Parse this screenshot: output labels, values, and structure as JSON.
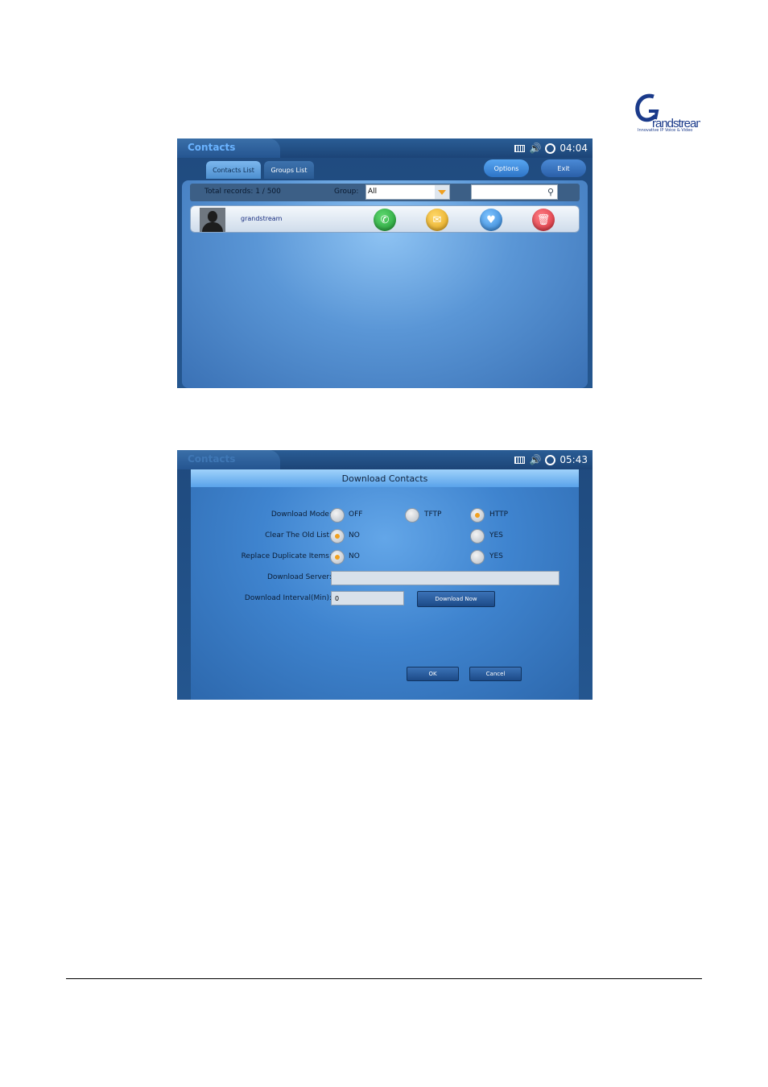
{
  "logo": {
    "text": "Grandstream",
    "tagline": "Innovative IP Voice & Video"
  },
  "screen1": {
    "app_title": "Contacts",
    "time": "04:04",
    "tabs": [
      "Contacts List",
      "Groups List"
    ],
    "options_label": "Options",
    "exit_label": "Exit",
    "total_records": "Total records: 1 / 500",
    "group_label": "Group:",
    "group_value": "All",
    "contact_name": "grandstream"
  },
  "screen2": {
    "app_title": "Contacts",
    "time": "05:43",
    "dialog_title": "Download Contacts",
    "download_mode_label": "Download Mode:",
    "mode_options": [
      "OFF",
      "TFTP",
      "HTTP"
    ],
    "clear_old_label": "Clear The Old List:",
    "clear_options": [
      "NO",
      "YES"
    ],
    "replace_dup_label": "Replace Duplicate Items:",
    "replace_options": [
      "NO",
      "YES"
    ],
    "server_label": "Download Server:",
    "server_value": "",
    "interval_label": "Download Interval(Min):",
    "interval_value": "0",
    "download_now_label": "Download Now",
    "ok_label": "OK",
    "cancel_label": "Cancel"
  }
}
